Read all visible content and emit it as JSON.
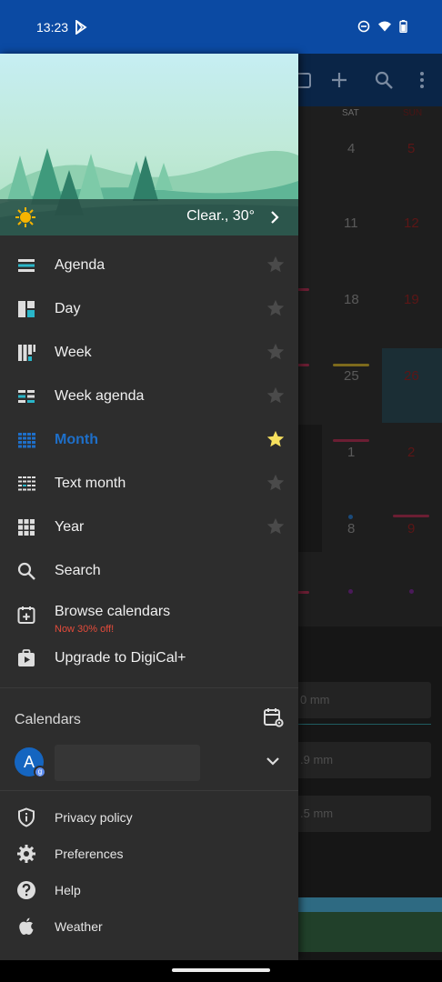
{
  "status_bar": {
    "time": "13:23",
    "icons": [
      "play-store-icon",
      "dnd-icon",
      "wifi-icon",
      "battery-icon"
    ]
  },
  "background": {
    "toolbar_icons": [
      "calendar-today-icon",
      "add-icon",
      "search-icon",
      "more-vert-icon"
    ],
    "day_headers": [
      "SAT",
      "SUN"
    ],
    "day_numbers": [
      "4",
      "5",
      "11",
      "12",
      "18",
      "19",
      "25",
      "26",
      "1",
      "2",
      "8",
      "9"
    ],
    "fields": [
      "0 mm",
      ".9 mm",
      ".5 mm"
    ]
  },
  "drawer": {
    "weather": {
      "text": "Clear., 30°",
      "icon": "sun-icon"
    },
    "menu": [
      {
        "label": "Agenda",
        "icon": "agenda-icon"
      },
      {
        "label": "Day",
        "icon": "day-icon"
      },
      {
        "label": "Week",
        "icon": "week-icon"
      },
      {
        "label": "Week agenda",
        "icon": "week-agenda-icon"
      },
      {
        "label": "Month",
        "icon": "month-icon",
        "active": true
      },
      {
        "label": "Text month",
        "icon": "text-month-icon"
      },
      {
        "label": "Year",
        "icon": "year-icon"
      },
      {
        "label": "Search",
        "icon": "search-icon"
      },
      {
        "label": "Browse calendars",
        "icon": "calendar-add-icon",
        "promo": "Now 30% off!"
      },
      {
        "label": "Upgrade to DigiCal+",
        "icon": "play-bag-icon"
      }
    ],
    "calendars": {
      "title": "Calendars",
      "account_initial": "A",
      "account_badge": "g"
    },
    "bottom": [
      {
        "label": "Privacy policy",
        "icon": "shield-icon"
      },
      {
        "label": "Preferences",
        "icon": "gear-icon"
      },
      {
        "label": "Help",
        "icon": "help-icon"
      },
      {
        "label": "Weather",
        "icon": "apple-icon"
      }
    ]
  },
  "colors": {
    "accent": "#1e6fc9",
    "status_bar": "#0b4aa3",
    "drawer_bg": "#2d2d2d",
    "star_active": "#f6e05e",
    "promo": "#e34b3b"
  }
}
